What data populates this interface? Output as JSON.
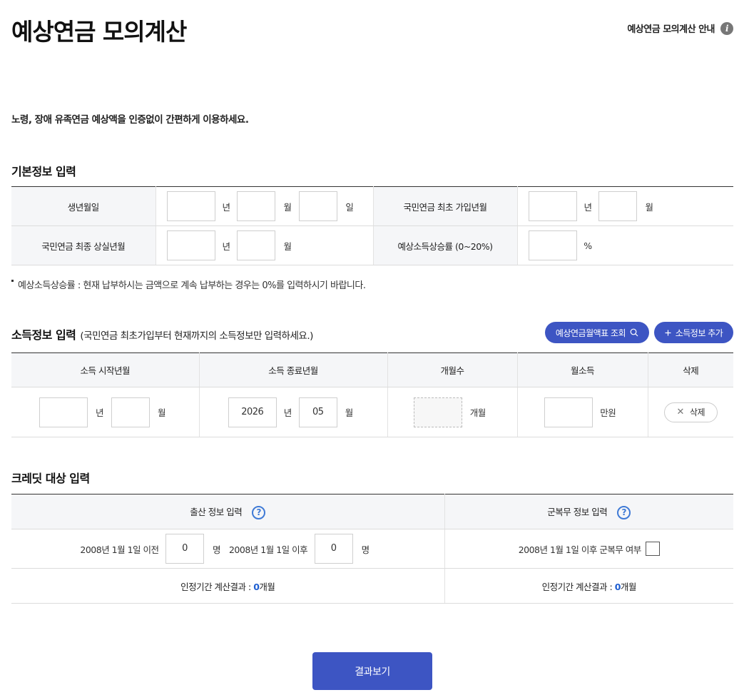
{
  "header": {
    "title": "예상연금 모의계산",
    "guide_link": "예상연금 모의계산 안내",
    "guide_icon_glyph": "i"
  },
  "intro": "노령, 장애 유족연금 예상액을 인증없이 간편하게 이용하세요.",
  "basic": {
    "section_title": "기본정보 입력",
    "birth_label": "생년월일",
    "first_join_label": "국민연금 최초 가입년월",
    "last_loss_label": "국민연금 최종 상실년월",
    "income_rate_label": "예상소득상승률 (0~20%)",
    "unit_year": "년",
    "unit_month": "월",
    "unit_day": "일",
    "unit_percent": "%",
    "note": "예상소득상승률 : 현재 납부하시는 금액으로 계속 납부하는 경우는 0%를 입력하시기 바랍니다."
  },
  "income": {
    "section_title": "소득정보 입력",
    "section_sub": "(국민연금 최초가입부터 현재까지의 소득정보만 입력하세요.)",
    "lookup_button": "예상연금월액표 조회",
    "add_button": "소득정보 추가",
    "columns": [
      "소득 시작년월",
      "소득 종료년월",
      "개월수",
      "월소득",
      "삭제"
    ],
    "row": {
      "start_year": "",
      "start_month": "",
      "end_year": "2026",
      "end_month": "05",
      "months": "",
      "monthly_income": ""
    },
    "unit_year": "년",
    "unit_month": "월",
    "unit_months": "개월",
    "unit_manwon": "만원",
    "delete_label": "삭제"
  },
  "credit": {
    "section_title": "크레딧 대상 입력",
    "birth_header": "출산 정보 입력",
    "military_header": "군복무 정보 입력",
    "before_label": "2008년 1월 1일 이전",
    "before_value": "0",
    "after_label": "2008년 1월 1일 이후",
    "after_value": "0",
    "unit_person": "명",
    "military_label": "2008년 1월 1일 이후 군복무 여부",
    "result_prefix": "인정기간 계산결과 : ",
    "birth_result_value": "0",
    "military_result_value": "0",
    "result_suffix": "개월"
  },
  "result_button": "결과보기",
  "colors": {
    "primary": "#3d55c3",
    "help_blue": "#3f7ad6",
    "result_blue": "#1f5fd1"
  }
}
